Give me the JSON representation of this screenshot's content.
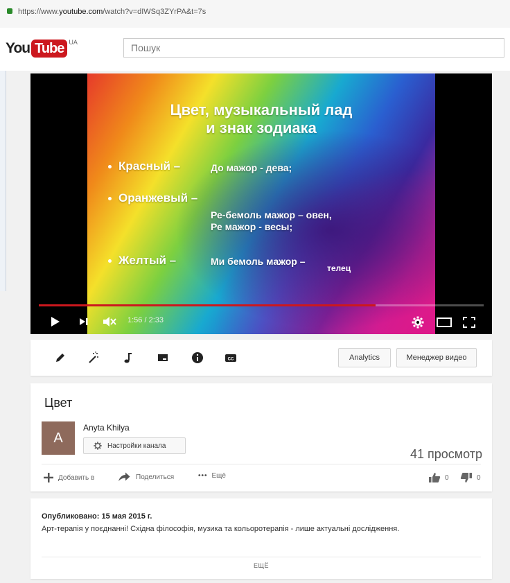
{
  "browser": {
    "url_prefix": "https://www.",
    "url_host": "youtube.com",
    "url_path": "/watch?v=dIWSq3ZYrPA&t=7s"
  },
  "header": {
    "logo_you": "You",
    "logo_tube": "Tube",
    "logo_region": "UA",
    "search_placeholder": "Пошук"
  },
  "player": {
    "slide_title_1": "Цвет, музыкальный лад",
    "slide_title_2": "и знак зодиака",
    "item_1_label": "Красный –",
    "item_1_value": "До мажор - дева;",
    "item_2_label": "Оранжевый –",
    "item_2_value_a": "Ре-бемоль мажор – овен,",
    "item_2_value_b": "Ре мажор - весы;",
    "item_3_label": "Желтый –",
    "item_3_value": "Ми бемоль мажор –",
    "item_3_extra": "телец",
    "time_display": "1:56 / 2:33",
    "progress": 0.757
  },
  "toolbar": {
    "analytics_label": "Analytics",
    "manager_label": "Менеджер видео"
  },
  "video": {
    "title": "Цвет",
    "channel_name": "Anyta Khilya",
    "avatar_letter": "A",
    "channel_settings_label": "Настройки канала",
    "views": "41 просмотр",
    "add_to_label": "Добавить в",
    "share_label": "Поделиться",
    "more_label": "Ещё",
    "likes": "0",
    "dislikes": "0"
  },
  "description": {
    "published": "Опубликовано: 15 мая 2015 г.",
    "text": "Арт-терапія у поєднанні! Східна філософія, музика та кольоротерапія - лише актуальні дослідження.",
    "show_more": "ЕЩЁ"
  },
  "colors": {
    "brand_red": "#cc181e",
    "avatar_bg": "#8e6a5c"
  }
}
